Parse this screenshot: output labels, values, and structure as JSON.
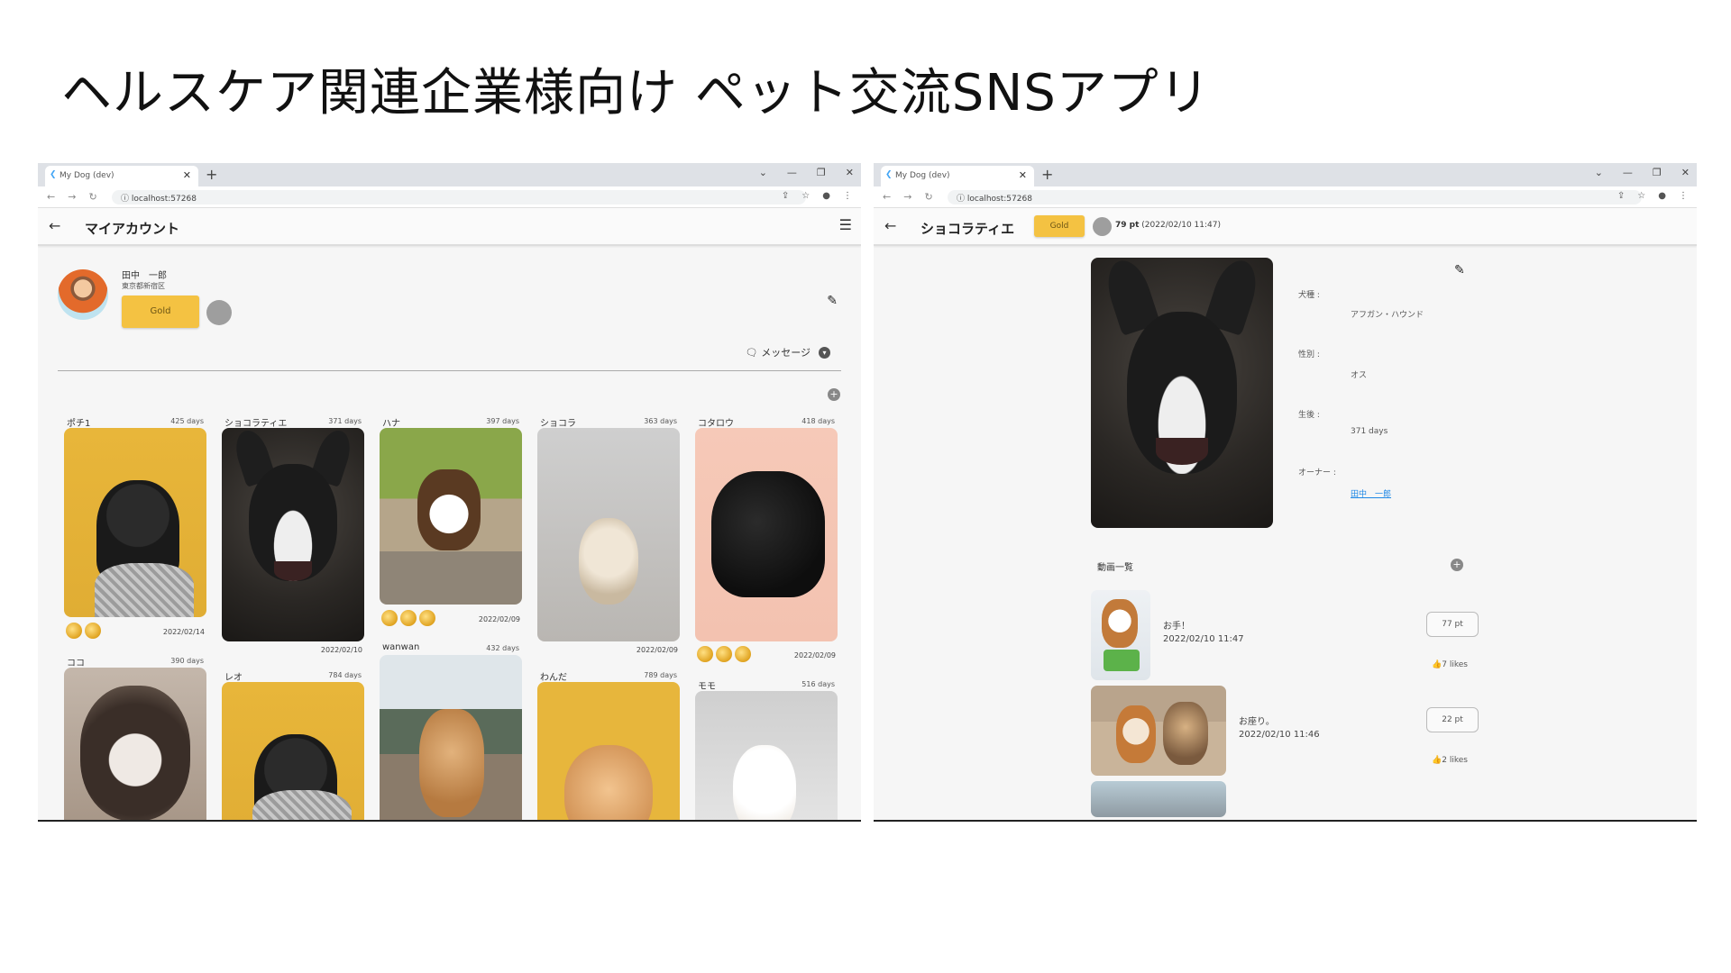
{
  "slide": {
    "title": "ヘルスケア関連企業様向け ペット交流SNSアプリ"
  },
  "browser": {
    "tab_title": "My Dog (dev)",
    "url": "localhost:57268",
    "new_tab": "+",
    "close_tab": "✕",
    "controls": [
      "⌄",
      "—",
      "❐",
      "✕"
    ]
  },
  "left": {
    "appbar_title": "マイアカウント",
    "profile": {
      "name": "田中　一郎",
      "location": "東京都新宿区",
      "rank_label": "Gold"
    },
    "message_label": "メッセージ",
    "dogs": [
      {
        "name": "ポチ1",
        "days": "425 days",
        "date": "2022/02/14",
        "medals": 2,
        "photo": "pug"
      },
      {
        "name": "ショコラティエ",
        "days": "371 days",
        "date": "2022/02/10",
        "medals": 0,
        "photo": "boston"
      },
      {
        "name": "ハナ",
        "days": "397 days",
        "date": "2022/02/09",
        "medals": 3,
        "photo": "grass"
      },
      {
        "name": "ショコラ",
        "days": "363 days",
        "date": "2022/02/09",
        "medals": 0,
        "photo": "grey"
      },
      {
        "name": "コタロウ",
        "days": "418 days",
        "date": "2022/02/09",
        "medals": 3,
        "photo": "pink"
      },
      {
        "name": "ココ",
        "days": "390 days",
        "photo": "husky"
      },
      {
        "name": "レオ",
        "days": "784 days",
        "photo": "pug"
      },
      {
        "name": "wanwan",
        "days": "432 days",
        "photo": "tree"
      },
      {
        "name": "わんだ",
        "days": "789 days",
        "photo": "yellow2"
      },
      {
        "name": "モモ",
        "days": "516 days",
        "photo": "sofa"
      }
    ]
  },
  "right": {
    "appbar_title": "ショコラティエ",
    "rank_label": "Gold",
    "points_value": "79 pt",
    "points_time": "(2022/02/10 11:47)",
    "fields": [
      {
        "label": "犬種 :",
        "value": "アフガン・ハウンド"
      },
      {
        "label": "性別 :",
        "value": "オス"
      },
      {
        "label": "生後 :",
        "value": "371 days"
      },
      {
        "label": "オーナー :",
        "value": "田中　一郎"
      }
    ],
    "videos_title": "動画一覧",
    "videos": [
      {
        "title": "お手！",
        "time": "2022/02/10 11:47",
        "points": "77 pt",
        "likes": "7 likes"
      },
      {
        "title": "お座り。",
        "time": "2022/02/10 11:46",
        "points": "22 pt",
        "likes": "2 likes"
      }
    ]
  },
  "colors": {
    "gold": "#f4c242",
    "link": "#1e88e5",
    "medal": "#e0a320"
  }
}
